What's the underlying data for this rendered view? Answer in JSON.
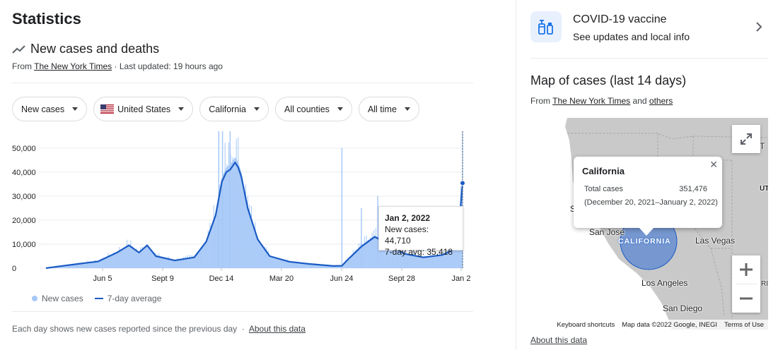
{
  "page_title": "Statistics",
  "section": {
    "title": "New cases and deaths",
    "source_prefix": "From",
    "source_link": "The New York Times",
    "updated": "· Last updated: 19 hours ago"
  },
  "filters": [
    {
      "label": "New cases"
    },
    {
      "label": "United States",
      "flag": "us-flag-icon"
    },
    {
      "label": "California"
    },
    {
      "label": "All counties"
    },
    {
      "label": "All time"
    }
  ],
  "chart_data": {
    "type": "bar",
    "y_ticks": [
      "50,000",
      "40,000",
      "30,000",
      "20,000",
      "10,000",
      "0"
    ],
    "x_ticks": [
      "Jun 5",
      "Sept 9",
      "Dec 14",
      "Mar 20",
      "Jun 24",
      "Sept 28",
      "Jan 2"
    ],
    "ylim": [
      0,
      57000
    ],
    "series": [
      {
        "name": "New cases",
        "color": "#a6c8f7"
      },
      {
        "name": "7-day average",
        "color": "#1a5bc4"
      }
    ],
    "seven_day_avg_points": [
      [
        "2020-03-10",
        0
      ],
      [
        "2020-04-01",
        800
      ],
      [
        "2020-05-01",
        1800
      ],
      [
        "2020-06-01",
        2800
      ],
      [
        "2020-07-01",
        6500
      ],
      [
        "2020-07-20",
        9500
      ],
      [
        "2020-08-05",
        6500
      ],
      [
        "2020-08-18",
        9500
      ],
      [
        "2020-09-01",
        5000
      ],
      [
        "2020-10-01",
        3200
      ],
      [
        "2020-11-01",
        4500
      ],
      [
        "2020-11-20",
        11000
      ],
      [
        "2020-12-05",
        22000
      ],
      [
        "2020-12-15",
        36000
      ],
      [
        "2020-12-22",
        40000
      ],
      [
        "2020-12-28",
        41000
      ],
      [
        "2021-01-05",
        44000
      ],
      [
        "2021-01-10",
        42000
      ],
      [
        "2021-01-15",
        38000
      ],
      [
        "2021-01-25",
        25000
      ],
      [
        "2021-02-10",
        12000
      ],
      [
        "2021-03-01",
        5000
      ],
      [
        "2021-04-01",
        2700
      ],
      [
        "2021-05-01",
        1800
      ],
      [
        "2021-06-10",
        900
      ],
      [
        "2021-06-24",
        1000
      ],
      [
        "2021-07-05",
        4000
      ],
      [
        "2021-07-25",
        9000
      ],
      [
        "2021-08-15",
        13000
      ],
      [
        "2021-09-01",
        11000
      ],
      [
        "2021-10-01",
        6000
      ],
      [
        "2021-11-01",
        4500
      ],
      [
        "2021-12-01",
        5500
      ],
      [
        "2021-12-20",
        8000
      ],
      [
        "2021-12-28",
        20000
      ],
      [
        "2022-01-02",
        35418
      ]
    ],
    "tooltip": {
      "date": "Jan 2, 2022",
      "new_cases": "New cases: 44,710",
      "avg": "7-day avg: 35,418"
    }
  },
  "legend": {
    "new_cases": "New cases",
    "avg": "7-day average"
  },
  "footnote": "Each day shows new cases reported since the previous day",
  "footnote_sep": "·",
  "about_link": "About this data",
  "vaccine": {
    "title": "COVID-19 vaccine",
    "subtitle": "See updates and local info"
  },
  "map": {
    "title": "Map of cases (last 14 days)",
    "source_prefix": "From",
    "source_link": "The New York Times",
    "and": "and",
    "others": "others",
    "popup": {
      "title": "California",
      "label": "Total cases",
      "value": "351,476",
      "range": "(December 20, 2021–January 2, 2022)"
    },
    "labels": {
      "california": "CALIFORNIA",
      "san_jose": "San Jose",
      "las_vegas": "Las Vegas",
      "los_angeles": "Los Angeles",
      "san_diego": "San Diego",
      "s": "S",
      "t": "T",
      "ut": "UT",
      "ri": "RI"
    },
    "attribution": {
      "shortcuts": "Keyboard shortcuts",
      "data": "Map data ©2022 Google, INEGI",
      "terms": "Terms of Use"
    },
    "about": "About this data"
  }
}
